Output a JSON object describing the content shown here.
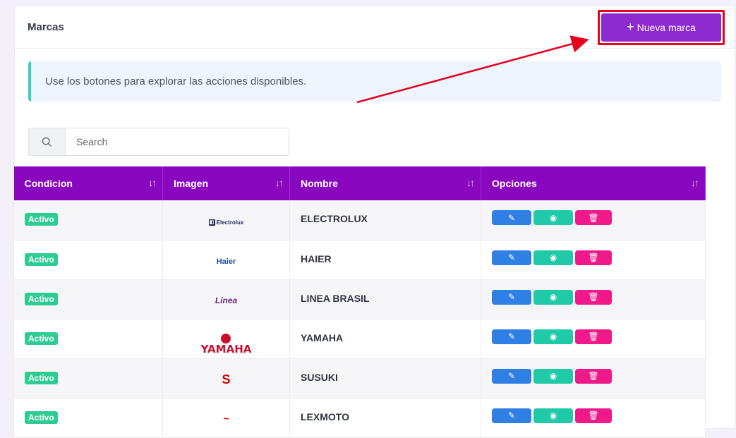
{
  "header": {
    "title": "Marcas",
    "new_button_label": "Nueva marca",
    "plus": "+"
  },
  "alert": {
    "text": "Use los botones para explorar las acciones disponibles."
  },
  "search": {
    "placeholder": "Search"
  },
  "table": {
    "columns": [
      "Condicion",
      "Imagen",
      "Nombre",
      "Opciones"
    ],
    "sort_glyph_down": "↓",
    "sort_glyph_up": "↑",
    "rows": [
      {
        "condicion": "Activo",
        "logo": "Electrolux",
        "nombre": "ELECTROLUX"
      },
      {
        "condicion": "Activo",
        "logo": "Haier",
        "nombre": "HAIER"
      },
      {
        "condicion": "Activo",
        "logo": "Linea",
        "nombre": "LINEA BRASIL"
      },
      {
        "condicion": "Activo",
        "logo": "YAMAHA",
        "nombre": "YAMAHA"
      },
      {
        "condicion": "Activo",
        "logo": "S",
        "nombre": "SUSUKI"
      },
      {
        "condicion": "Activo",
        "logo": "~",
        "nombre": "LEXMOTO"
      }
    ]
  },
  "icons": {
    "search": "search-icon",
    "edit": "edit-icon",
    "view": "eye-icon",
    "delete": "trash-icon"
  },
  "colors": {
    "accent": "#8a07c0",
    "button": "#8e2bd0",
    "badge": "#2ecc92",
    "edit": "#2f7fe4",
    "view": "#20c9a8",
    "delete": "#f0198a",
    "annotation": "#e6001e"
  }
}
